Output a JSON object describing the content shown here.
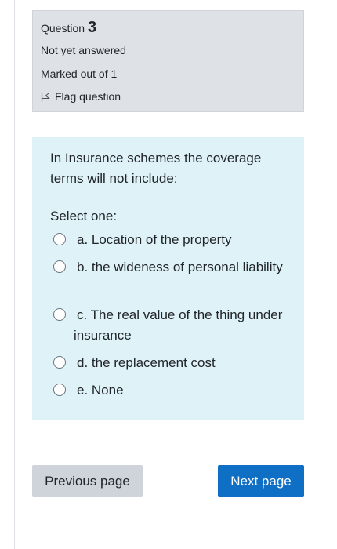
{
  "info": {
    "question_word": "Question",
    "question_number": "3",
    "state": "Not yet answered",
    "grade": "Marked out of 1",
    "flag_label": "Flag question"
  },
  "question": {
    "text": "In Insurance schemes the coverage terms will not include:",
    "prompt": "Select one:",
    "options": [
      {
        "label": "a. Location of the property"
      },
      {
        "label": "b. the wideness of personal liability"
      },
      {
        "label": "c. The real value of the thing under insurance"
      },
      {
        "label": "d. the replacement cost"
      },
      {
        "label": "e. None"
      }
    ]
  },
  "navigation": {
    "previous_label": "Previous page",
    "next_label": "Next page"
  },
  "colors": {
    "info_bg": "#dee2e6",
    "content_bg": "#def2f8",
    "next_button": "#0f6fc5",
    "prev_button": "#ced4da"
  }
}
